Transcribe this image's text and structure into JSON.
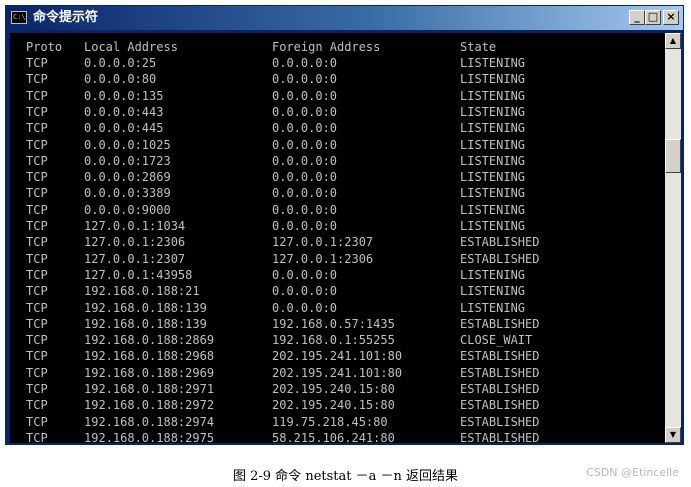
{
  "window": {
    "title": "命令提示符",
    "icon": "cmd-icon",
    "controls": {
      "minimize": "_",
      "maximize": "□",
      "close": "×"
    }
  },
  "console": {
    "header": [
      "Proto",
      "Local Address",
      "Foreign Address",
      "State"
    ],
    "rows": [
      [
        "TCP",
        "0.0.0.0:25",
        "0.0.0.0:0",
        "LISTENING"
      ],
      [
        "TCP",
        "0.0.0.0:80",
        "0.0.0.0:0",
        "LISTENING"
      ],
      [
        "TCP",
        "0.0.0.0:135",
        "0.0.0.0:0",
        "LISTENING"
      ],
      [
        "TCP",
        "0.0.0.0:443",
        "0.0.0.0:0",
        "LISTENING"
      ],
      [
        "TCP",
        "0.0.0.0:445",
        "0.0.0.0:0",
        "LISTENING"
      ],
      [
        "TCP",
        "0.0.0.0:1025",
        "0.0.0.0:0",
        "LISTENING"
      ],
      [
        "TCP",
        "0.0.0.0:1723",
        "0.0.0.0:0",
        "LISTENING"
      ],
      [
        "TCP",
        "0.0.0.0:2869",
        "0.0.0.0:0",
        "LISTENING"
      ],
      [
        "TCP",
        "0.0.0.0:3389",
        "0.0.0.0:0",
        "LISTENING"
      ],
      [
        "TCP",
        "0.0.0.0:9000",
        "0.0.0.0:0",
        "LISTENING"
      ],
      [
        "TCP",
        "127.0.0.1:1034",
        "0.0.0.0:0",
        "LISTENING"
      ],
      [
        "TCP",
        "127.0.0.1:2306",
        "127.0.0.1:2307",
        "ESTABLISHED"
      ],
      [
        "TCP",
        "127.0.0.1:2307",
        "127.0.0.1:2306",
        "ESTABLISHED"
      ],
      [
        "TCP",
        "127.0.0.1:43958",
        "0.0.0.0:0",
        "LISTENING"
      ],
      [
        "TCP",
        "192.168.0.188:21",
        "0.0.0.0:0",
        "LISTENING"
      ],
      [
        "TCP",
        "192.168.0.188:139",
        "0.0.0.0:0",
        "LISTENING"
      ],
      [
        "TCP",
        "192.168.0.188:139",
        "192.168.0.57:1435",
        "ESTABLISHED"
      ],
      [
        "TCP",
        "192.168.0.188:2869",
        "192.168.0.1:55255",
        "CLOSE_WAIT"
      ],
      [
        "TCP",
        "192.168.0.188:2968",
        "202.195.241.101:80",
        "ESTABLISHED"
      ],
      [
        "TCP",
        "192.168.0.188:2969",
        "202.195.241.101:80",
        "ESTABLISHED"
      ],
      [
        "TCP",
        "192.168.0.188:2971",
        "202.195.240.15:80",
        "ESTABLISHED"
      ],
      [
        "TCP",
        "192.168.0.188:2972",
        "202.195.240.15:80",
        "ESTABLISHED"
      ],
      [
        "TCP",
        "192.168.0.188:2974",
        "119.75.218.45:80",
        "ESTABLISHED"
      ],
      [
        "TCP",
        "192.168.0.188:2975",
        "58.215.106.241:80",
        "ESTABLISHED"
      ]
    ]
  },
  "scrollbar": {
    "up_arrow": "▲",
    "down_arrow": "▼"
  },
  "caption": "图 2-9  命令 netstat  －a  －n  返回结果",
  "watermark": "CSDN @Etincelle",
  "colors": {
    "titlebar_start": "#0a246a",
    "titlebar_end": "#a6caf0",
    "console_bg": "#000000",
    "console_text": "#c0c0c0"
  }
}
